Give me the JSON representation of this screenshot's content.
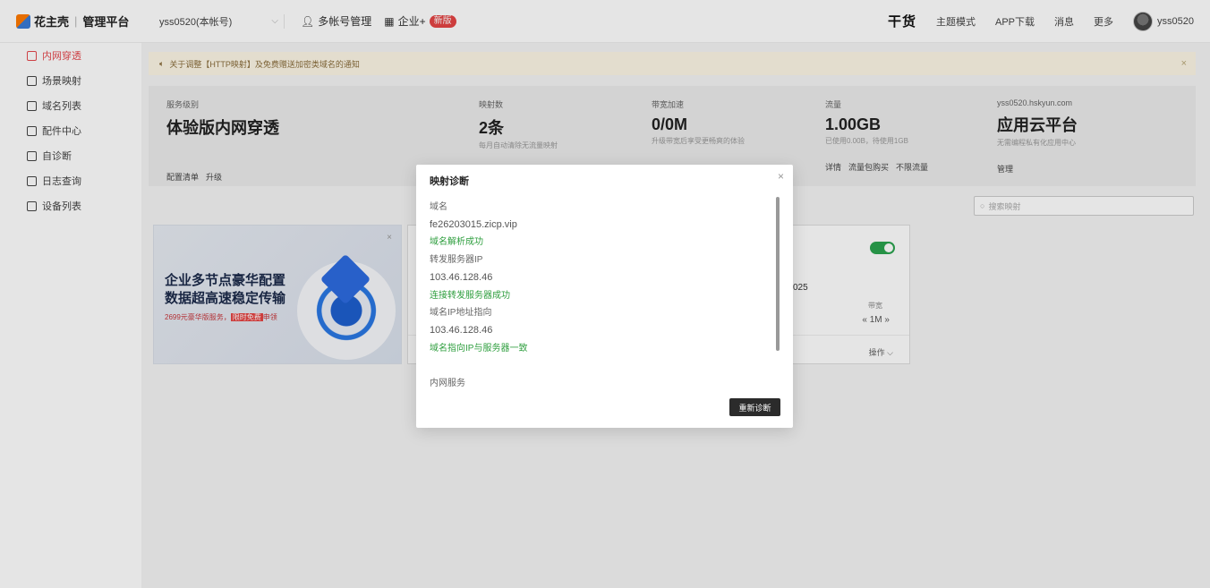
{
  "brand": {
    "name": "花主壳",
    "subtitle": "管理平台"
  },
  "account": {
    "name": "yss0520(本帐号)"
  },
  "topnav": {
    "multi_account": "多帐号管理",
    "enterprise": "企业+",
    "new_badge": "新版"
  },
  "topright": {
    "ganhuo": "干货",
    "theme": "主题模式",
    "app": "APP下载",
    "messages": "消息",
    "more": "更多",
    "username": "yss0520"
  },
  "sidebar": {
    "items": [
      {
        "label": "内网穿透",
        "active": true,
        "icon": "tunnel-icon"
      },
      {
        "label": "场景映射",
        "icon": "scene-icon"
      },
      {
        "label": "域名列表",
        "icon": "domain-icon"
      },
      {
        "label": "配件中心",
        "icon": "parts-icon"
      },
      {
        "label": "自诊断",
        "icon": "diagnose-icon"
      },
      {
        "label": "日志查询",
        "icon": "log-icon"
      },
      {
        "label": "设备列表",
        "icon": "device-icon"
      }
    ]
  },
  "notice": {
    "text": "关于调整【HTTP映射】及免费赠送加密类域名的通知",
    "close": "×"
  },
  "stats": {
    "service": {
      "label": "服务级别",
      "value": "体验版内网穿透",
      "link1": "配置清单",
      "link2": "升级"
    },
    "mappings": {
      "label": "映射数",
      "value": "2条",
      "sub": "每月自动清除无流量映射"
    },
    "bandwidth": {
      "label": "带宽加速",
      "value": "0/0M",
      "sub": "升级带宽后享受更畅爽的体验"
    },
    "traffic": {
      "label": "流量",
      "value": "1.00GB",
      "sub": "已使用0.00B，待使用1GB",
      "link1": "详情",
      "link2": "流量包购买",
      "link3": "不限流量"
    },
    "cloud": {
      "label": "yss0520.hskyun.com",
      "value": "应用云平台",
      "sub": "无需编程私有化应用中心",
      "link1": "管理"
    }
  },
  "search": {
    "placeholder": "搜索映射"
  },
  "promo": {
    "line1": "企业多节点豪华配置",
    "line2": "数据超高速稳定传输",
    "price": "2699元豪华版服务，",
    "highlight": "限时免费",
    "apply": "申领"
  },
  "card": {
    "fragment": "025",
    "bw_label": "带宽",
    "bw_value": "1M",
    "ops": "操作"
  },
  "modal": {
    "title": "映射诊断",
    "close": "×",
    "lines": {
      "domain_label": "域名",
      "domain_value": "fe26203015.zicp.vip",
      "domain_ok": "域名解析成功",
      "server_label": "转发服务器IP",
      "server_value": "103.46.128.46",
      "server_ok": "连接转发服务器成功",
      "ip_label": "域名IP地址指向",
      "ip_value": "103.46.128.46",
      "ip_ok": "域名指向IP与服务器一致",
      "internal_label": "内网服务"
    },
    "button": "重新诊断"
  },
  "colors": {
    "active": "#e5484d",
    "ok": "#2e9e3e",
    "toggle": "#2ba34f"
  }
}
